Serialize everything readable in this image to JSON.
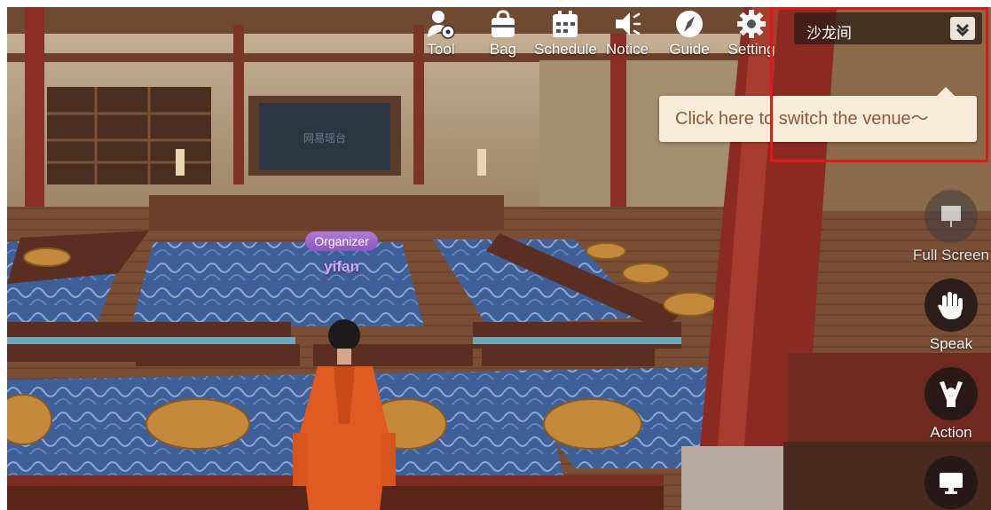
{
  "toolbar": {
    "items": [
      {
        "label": "Tool",
        "icon": "person-gear-icon"
      },
      {
        "label": "Bag",
        "icon": "bag-icon"
      },
      {
        "label": "Schedule",
        "icon": "calendar-icon"
      },
      {
        "label": "Notice",
        "icon": "megaphone-icon"
      },
      {
        "label": "Guide",
        "icon": "compass-icon"
      },
      {
        "label": "Setting",
        "icon": "gear-icon"
      }
    ]
  },
  "venue": {
    "name": "沙龙间",
    "dropdown_icon": "chevron-down-icon"
  },
  "hint": {
    "text": "Click here to switch the venue～"
  },
  "side": {
    "full_screen": "Full Screen",
    "speak": "Speak",
    "action": "Action",
    "screen_icon": "monitor-icon"
  },
  "player": {
    "role": "Organizer",
    "name": "yifan"
  },
  "scene": {
    "screen_text": "网易瑶台"
  },
  "colors": {
    "highlight_box": "#e01818",
    "hint_bg": "#f6ecd9",
    "hint_text": "#8a5a3a",
    "role_tag": "#9a64c9",
    "player_name": "#d6a7ff"
  }
}
